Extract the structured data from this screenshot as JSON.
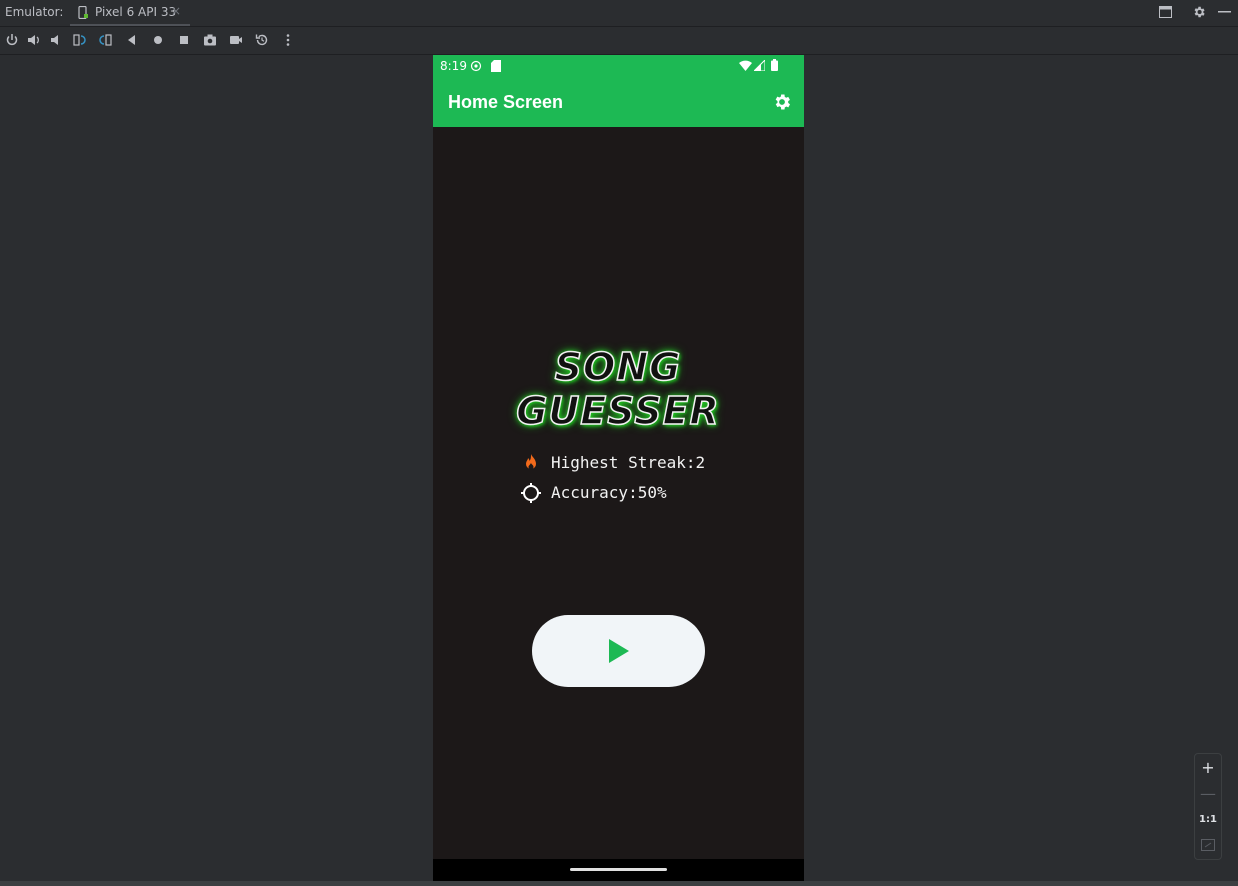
{
  "ide": {
    "title_label": "Emulator:",
    "tab": {
      "label": "Pixel 6 API 33",
      "close": "×"
    },
    "toolbar": [
      "power-icon",
      "volume-up-icon",
      "volume-down-icon",
      "rotate-left-icon",
      "rotate-right-icon",
      "back-icon",
      "home-icon",
      "overview-icon",
      "screenshot-icon",
      "screen-record-icon",
      "snapshot-icon",
      "more-icon"
    ],
    "zoom": {
      "plus": "+",
      "minus": "—",
      "actual": "1:1"
    }
  },
  "phone": {
    "status": {
      "time": "8:19"
    },
    "appbar": {
      "title": "Home Screen"
    },
    "logo": {
      "line1": "SONG",
      "line2": "GUESSER"
    },
    "stats": {
      "streak": "Highest Streak:2",
      "accuracy": "Accuracy:50%"
    },
    "colors": {
      "accent": "#1db954",
      "background": "#1c1818",
      "button": "#f1f5f8"
    }
  }
}
